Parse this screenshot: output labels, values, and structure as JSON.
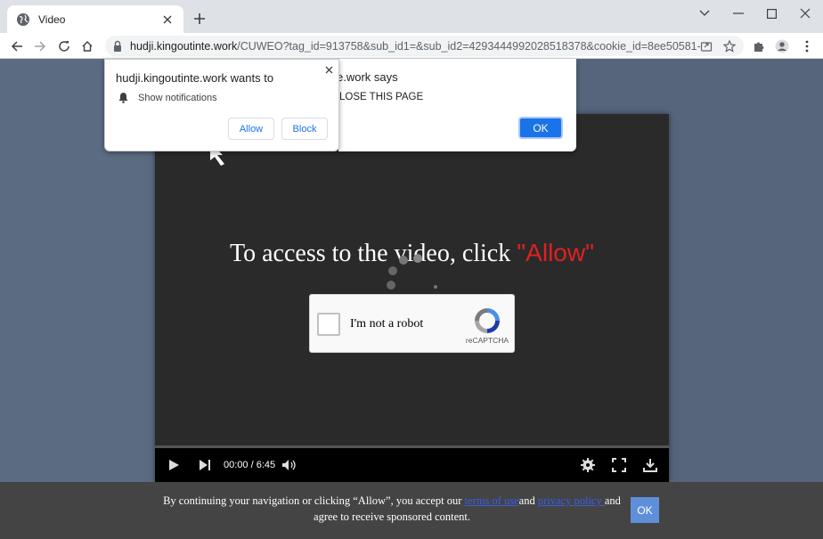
{
  "browser": {
    "tab_title": "Video",
    "url_host": "hudji.kingoutinte.work",
    "url_path": "/CUWEO?tag_id=913758&sub_id1=&sub_id2=4293444992028518378&cookie_id=8ee50581-728b-4..."
  },
  "notification_prompt": {
    "title": "hudji.kingoutinte.work wants to",
    "message": "Show notifications",
    "allow_label": "Allow",
    "block_label": "Block"
  },
  "alert_dialog": {
    "title": "e.work says",
    "message": "LOSE THIS PAGE",
    "ok_label": "OK"
  },
  "video": {
    "headline_prefix": "To access to the video, click ",
    "headline_highlight": "\"Allow\"",
    "time": "00:00 / 6:45",
    "progress": 0.0
  },
  "recaptcha": {
    "label": "I'm not a robot",
    "brand": "reCAPTCHA"
  },
  "cookie_banner": {
    "text_before": "By continuing your navigation or clicking “Allow”, you accept our ",
    "terms_link": "terms of use",
    "text_and": "and ",
    "privacy_link": "privacy policy ",
    "text_after": "and agree to receive sponsored content.",
    "ok_label": "OK"
  },
  "colors": {
    "accent": "#1a73e8",
    "highlight": "#e02020"
  }
}
